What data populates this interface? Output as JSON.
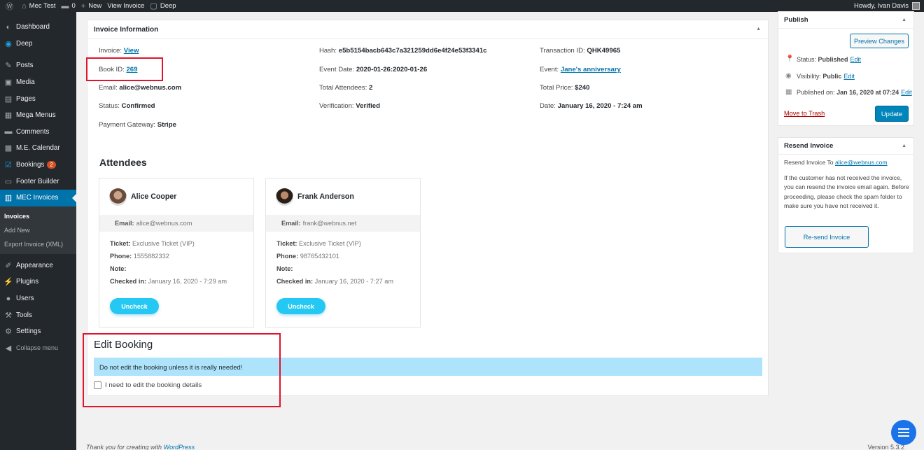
{
  "adminbar": {
    "site": "Mec Test",
    "comments": "0",
    "new": "New",
    "view": "View Invoice",
    "deep": "Deep",
    "howdy": "Howdy, Ivan Davis"
  },
  "sidebar": {
    "items": [
      {
        "label": "Dashboard",
        "icon": "dashboard-icon"
      },
      {
        "label": "Deep",
        "icon": "deep-icon"
      },
      {
        "label": "Posts",
        "icon": "pin-icon"
      },
      {
        "label": "Media",
        "icon": "media-icon"
      },
      {
        "label": "Pages",
        "icon": "pages-icon"
      },
      {
        "label": "Mega Menus",
        "icon": "menu-icon"
      },
      {
        "label": "Comments",
        "icon": "comment-icon"
      },
      {
        "label": "M.E. Calendar",
        "icon": "calendar-icon"
      },
      {
        "label": "Bookings",
        "icon": "bookings-icon",
        "badge": "2"
      },
      {
        "label": "Footer Builder",
        "icon": "footer-icon"
      },
      {
        "label": "MEC Invoices",
        "icon": "invoice-icon"
      }
    ],
    "sub": [
      "Invoices",
      "Add New",
      "Export Invoice (XML)"
    ],
    "items2": [
      {
        "label": "Appearance",
        "icon": "brush-icon"
      },
      {
        "label": "Plugins",
        "icon": "plug-icon"
      },
      {
        "label": "Users",
        "icon": "users-icon"
      },
      {
        "label": "Tools",
        "icon": "wrench-icon"
      },
      {
        "label": "Settings",
        "icon": "settings-icon"
      }
    ],
    "collapse": "Collapse menu"
  },
  "invoice": {
    "title": "Invoice Information",
    "invoice_label": "Invoice:",
    "invoice_link": "View",
    "bookid_label": "Book ID:",
    "bookid": "269",
    "email_label": "Email:",
    "email": "alice@webnus.com",
    "status_label": "Status:",
    "status": "Confirmed",
    "gateway_label": "Payment Gateway:",
    "gateway": "Stripe",
    "hash_label": "Hash:",
    "hash": "e5b5154bacb643c7a321259dd6e4f24e53f3341c",
    "eventdate_label": "Event Date:",
    "eventdate": "2020-01-26:2020-01-26",
    "attendees_label": "Total Attendees:",
    "attendees": "2",
    "verif_label": "Verification:",
    "verif": "Verified",
    "txn_label": "Transaction ID:",
    "txn": "QHK49965",
    "event_label": "Event:",
    "event": "Jane's anniversary",
    "price_label": "Total Price:",
    "price": "$240",
    "date_label": "Date:",
    "date": "January 16, 2020 - 7:24 am"
  },
  "attendees_title": "Attendees",
  "cards": [
    {
      "name": "Alice Cooper",
      "email": "alice@webnus.com",
      "ticket": "Exclusive Ticket (VIP)",
      "phone": "1555882332",
      "checkin": "January 16, 2020 - 7:29 am",
      "btn": "Uncheck"
    },
    {
      "name": "Frank Anderson",
      "email": "frank@webnus.net",
      "ticket": "Exclusive Ticket (VIP)",
      "phone": "98765432101",
      "checkin": "January 16, 2020 - 7:27 am",
      "btn": "Uncheck"
    }
  ],
  "labels": {
    "email": "Email:",
    "ticket": "Ticket:",
    "phone": "Phone:",
    "note": "Note:",
    "checked": "Checked in:"
  },
  "edit": {
    "title": "Edit Booking",
    "notice": "Do not edit the booking unless it is really needed!",
    "checkbox": "I need to edit the booking details"
  },
  "publish": {
    "title": "Publish",
    "preview": "Preview Changes",
    "status_label": "Status:",
    "status": "Published",
    "vis_label": "Visibility:",
    "vis": "Public",
    "pub_label": "Published on:",
    "pub": "Jan 16, 2020 at 07:24",
    "edit": "Edit",
    "trash": "Move to Trash",
    "update": "Update"
  },
  "resend": {
    "title": "Resend Invoice",
    "to_label": "Resend Invoice To",
    "to": "alice@webnus.com",
    "text": "If the customer has not received the invoice, you can resend the invoice email again. Before proceeding, please check the spam folder to make sure you have not received it.",
    "btn": "Re-send Invoice"
  },
  "footer": {
    "text": "Thank you for creating with",
    "link": "WordPress",
    "version": "Version 5.3.2"
  },
  "colors": {
    "accent": "#0073aa",
    "highlight": "#e0142a",
    "notice": "#aee4fb",
    "uncheck": "#24c8f2"
  }
}
